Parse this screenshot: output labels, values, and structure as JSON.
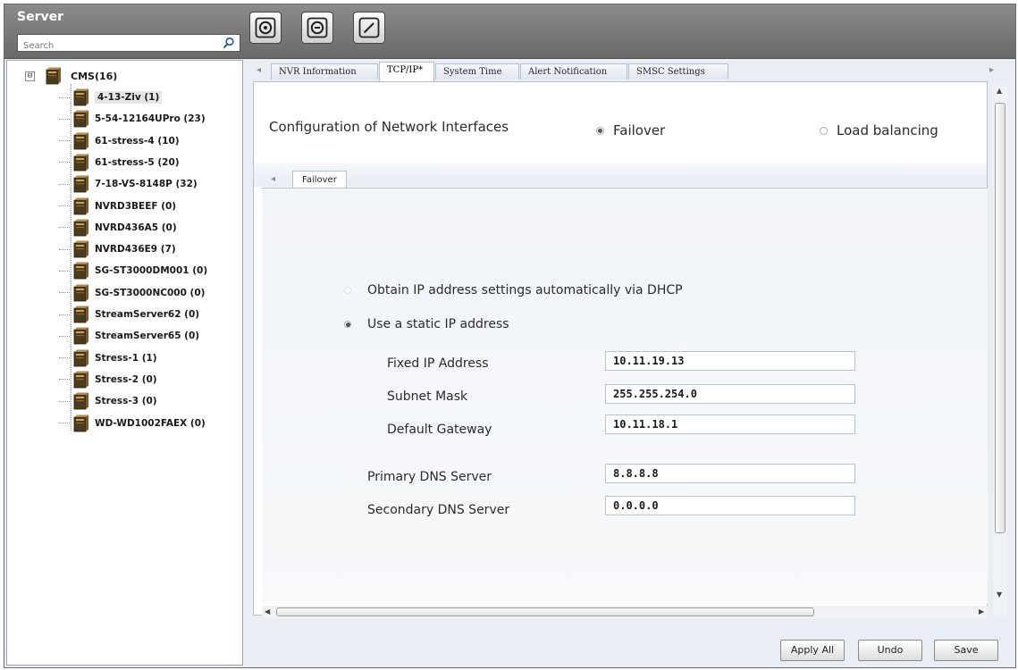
{
  "colors": {
    "topbar": "#7a7a7a",
    "panel_bg": "#e9eef5",
    "accent_border": "#b5c0cd"
  },
  "header": {
    "title": "Server",
    "search": {
      "placeholder": "Search",
      "value": "",
      "icon": "search-icon"
    },
    "toolbar": [
      {
        "name": "add-server-button",
        "icon": "add-circle-icon"
      },
      {
        "name": "remove-server-button",
        "icon": "remove-circle-icon"
      },
      {
        "name": "edit-server-button",
        "icon": "pencil-icon"
      }
    ]
  },
  "tree": {
    "root": {
      "label": "CMS(16)",
      "expander": "⊟"
    },
    "items": [
      {
        "label": "4-13-Ziv (1)",
        "selected": true
      },
      {
        "label": "5-54-12164UPro (23)"
      },
      {
        "label": "61-stress-4 (10)"
      },
      {
        "label": "61-stress-5 (20)"
      },
      {
        "label": "7-18-VS-8148P (32)"
      },
      {
        "label": "NVRD3BEEF (0)"
      },
      {
        "label": "NVRD436A5 (0)"
      },
      {
        "label": "NVRD436E9 (7)"
      },
      {
        "label": "SG-ST3000DM001 (0)"
      },
      {
        "label": "SG-ST3000NC000 (0)"
      },
      {
        "label": "StreamServer62 (0)"
      },
      {
        "label": "StreamServer65 (0)"
      },
      {
        "label": "Stress-1 (1)"
      },
      {
        "label": "Stress-2 (0)"
      },
      {
        "label": "Stress-3 (0)"
      },
      {
        "label": "WD-WD1002FAEX (0)"
      }
    ]
  },
  "tabs": [
    {
      "label": "NVR Information"
    },
    {
      "label": "TCP/IP*",
      "active": true
    },
    {
      "label": "System Time"
    },
    {
      "label": "Alert Notification"
    },
    {
      "label": "SMSC Settings"
    }
  ],
  "config": {
    "label": "Configuration of Network Interfaces",
    "options": [
      {
        "label": "Failover",
        "selected": true
      },
      {
        "label": "Load balancing",
        "selected": false
      }
    ]
  },
  "inner_tab": {
    "label": "Failover"
  },
  "ip_options": [
    {
      "label": "Obtain IP address settings automatically via DHCP",
      "selected": false
    },
    {
      "label": "Use a static IP address",
      "selected": true
    }
  ],
  "fields": {
    "fixed_ip": {
      "label": "Fixed IP Address",
      "value": "10.11.19.13"
    },
    "subnet": {
      "label": "Subnet Mask",
      "value": "255.255.254.0"
    },
    "gateway": {
      "label": "Default Gateway",
      "value": "10.11.18.1"
    },
    "dns1": {
      "label": "Primary DNS Server",
      "value": "8.8.8.8"
    },
    "dns2": {
      "label": "Secondary DNS Server",
      "value": "0.0.0.0"
    }
  },
  "buttons": {
    "apply_all": "Apply All",
    "undo": "Undo",
    "save": "Save"
  }
}
